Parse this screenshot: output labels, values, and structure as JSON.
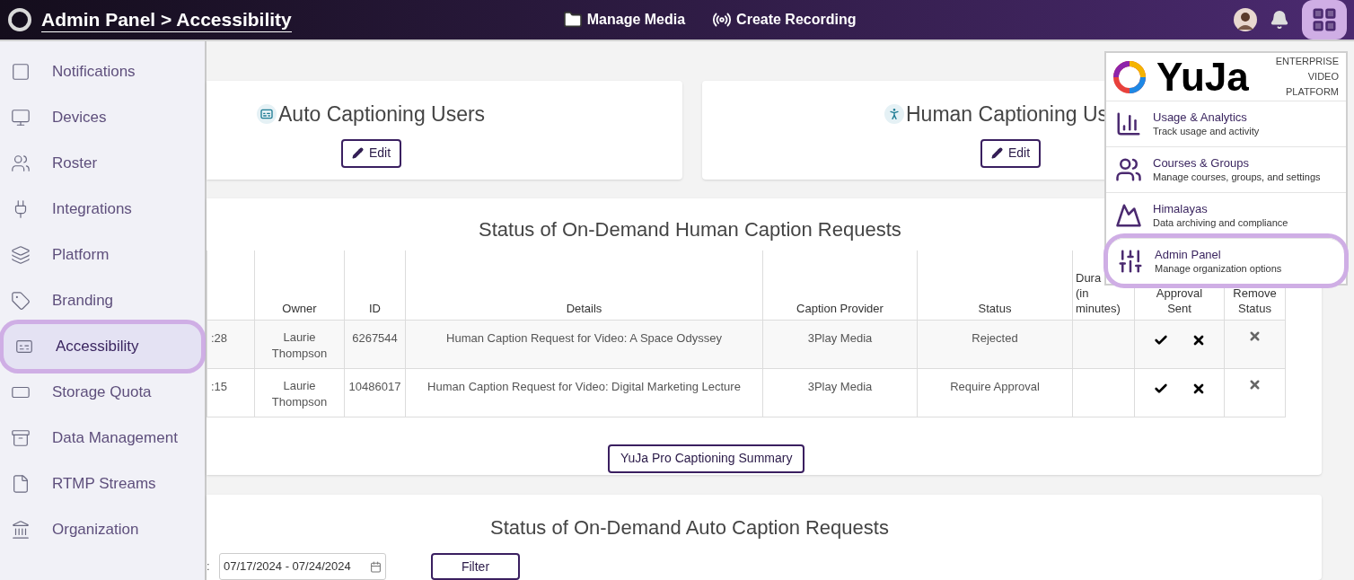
{
  "header": {
    "breadcrumb": "Admin Panel > Accessibility",
    "nav": [
      {
        "label": "Manage Media"
      },
      {
        "label": "Create Recording"
      }
    ],
    "apps_button": {
      "selected": true
    }
  },
  "sidebar": {
    "items": [
      {
        "label": "Notifications",
        "selected": false
      },
      {
        "label": "Devices",
        "selected": false
      },
      {
        "label": "Roster",
        "selected": false
      },
      {
        "label": "Integrations",
        "selected": false
      },
      {
        "label": "Platform",
        "selected": false
      },
      {
        "label": "Branding",
        "selected": false
      },
      {
        "label": "Accessibility",
        "selected": true
      },
      {
        "label": "Storage Quota",
        "selected": false
      },
      {
        "label": "Data Management",
        "selected": false
      },
      {
        "label": "RTMP Streams",
        "selected": false
      },
      {
        "label": "Organization",
        "selected": false
      }
    ]
  },
  "user_cards": [
    {
      "kind": "cc",
      "title": "Auto Captioning Users",
      "button": "Edit"
    },
    {
      "kind": "person",
      "title": "Human Captioning Us",
      "button": "Edit"
    }
  ],
  "human_requests": {
    "title": "Status of On-Demand Human Caption Requests",
    "columns": [
      {},
      {
        "lines": [
          "Owner"
        ]
      },
      {
        "lines": [
          "ID"
        ]
      },
      {
        "lines": [
          "Details"
        ]
      },
      {
        "lines": [
          "Caption Provider"
        ]
      },
      {
        "lines": [
          "Status"
        ]
      },
      {
        "lines": [
          "Dura",
          "(in",
          "minutes)"
        ]
      },
      {
        "lines": [
          "Approval",
          "Sent"
        ]
      },
      {
        "lines": [
          "Remove",
          "Status"
        ]
      }
    ],
    "rows": [
      {
        "time": ":28",
        "owner": "Laurie Thompson",
        "id": "6267544",
        "details": "Human Caption Request for Video: A Space Odyssey",
        "provider": "3Play Media",
        "status": "Rejected"
      },
      {
        "time": ":15",
        "owner": "Laurie Thompson",
        "id": "10486017",
        "details": "Human Caption Request for Video: Digital Marketing Lecture",
        "provider": "3Play Media",
        "status": "Require Approval"
      }
    ],
    "summary_button": "YuJa Pro Captioning Summary"
  },
  "auto_requests": {
    "title": "Status of On-Demand Auto Caption Requests",
    "date_label": ":",
    "date_range": "07/17/2024 - 07/24/2024",
    "filter_button": "Filter"
  },
  "apps_menu": {
    "brand": "YuJa",
    "tagline": [
      "ENTERPRISE",
      "VIDEO",
      "PLATFORM"
    ],
    "items": [
      {
        "title": "Usage & Analytics",
        "subtitle": "Track usage and activity",
        "selected": false
      },
      {
        "title": "Courses & Groups",
        "subtitle": "Manage courses, groups, and settings",
        "selected": false
      },
      {
        "title": "Himalayas",
        "subtitle": "Data archiving and compliance",
        "selected": false
      },
      {
        "title": "Admin Panel",
        "subtitle": "Manage organization options",
        "selected": true
      }
    ]
  }
}
